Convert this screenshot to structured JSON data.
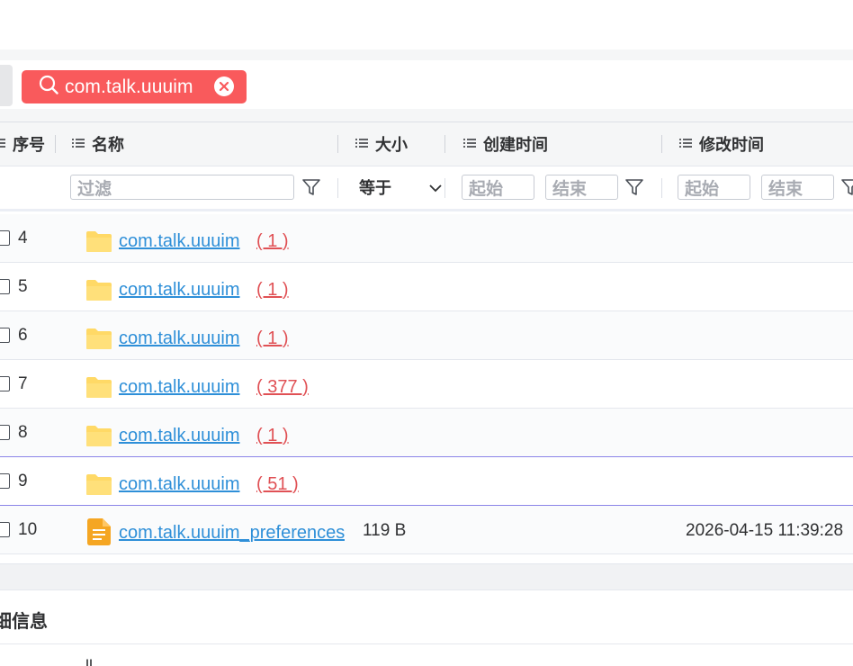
{
  "search": {
    "chip_text": "com.talk.uuuim",
    "chip_color": "#f95a5c"
  },
  "table": {
    "columns": [
      "序号",
      "名称",
      "大小",
      "创建时间",
      "修改时间"
    ],
    "filters": {
      "name_placeholder": "过滤",
      "size_operator": "等于",
      "created_start": "起始",
      "created_end": "结束",
      "modified_start": "起始",
      "modified_end": "结束"
    },
    "rows": [
      {
        "index": "4",
        "name": "com.talk.uuuim",
        "count": "( 1 )",
        "size": "",
        "modified": ""
      },
      {
        "index": "5",
        "name": "com.talk.uuuim",
        "count": "( 1 )",
        "size": "",
        "modified": ""
      },
      {
        "index": "6",
        "name": "com.talk.uuuim",
        "count": "( 1 )",
        "size": "",
        "modified": ""
      },
      {
        "index": "7",
        "name": "com.talk.uuuim",
        "count": "( 377 )",
        "size": "",
        "modified": ""
      },
      {
        "index": "8",
        "name": "com.talk.uuuim",
        "count": "( 1 )",
        "size": "",
        "modified": ""
      },
      {
        "index": "9",
        "name": "com.talk.uuuim",
        "count": "( 51 )",
        "size": "",
        "modified": ""
      },
      {
        "index": "10",
        "name": "com.talk.uuuim_preferences",
        "count": "",
        "size": "119 B",
        "modified": "2026-04-15 11:39:28"
      }
    ]
  },
  "detail": {
    "title": "细信息",
    "partial_text": "ll  "
  },
  "colors": {
    "link": "#2e8fd8",
    "count": "#e05155",
    "folder": "#ffd966",
    "file": "#f5a623"
  }
}
